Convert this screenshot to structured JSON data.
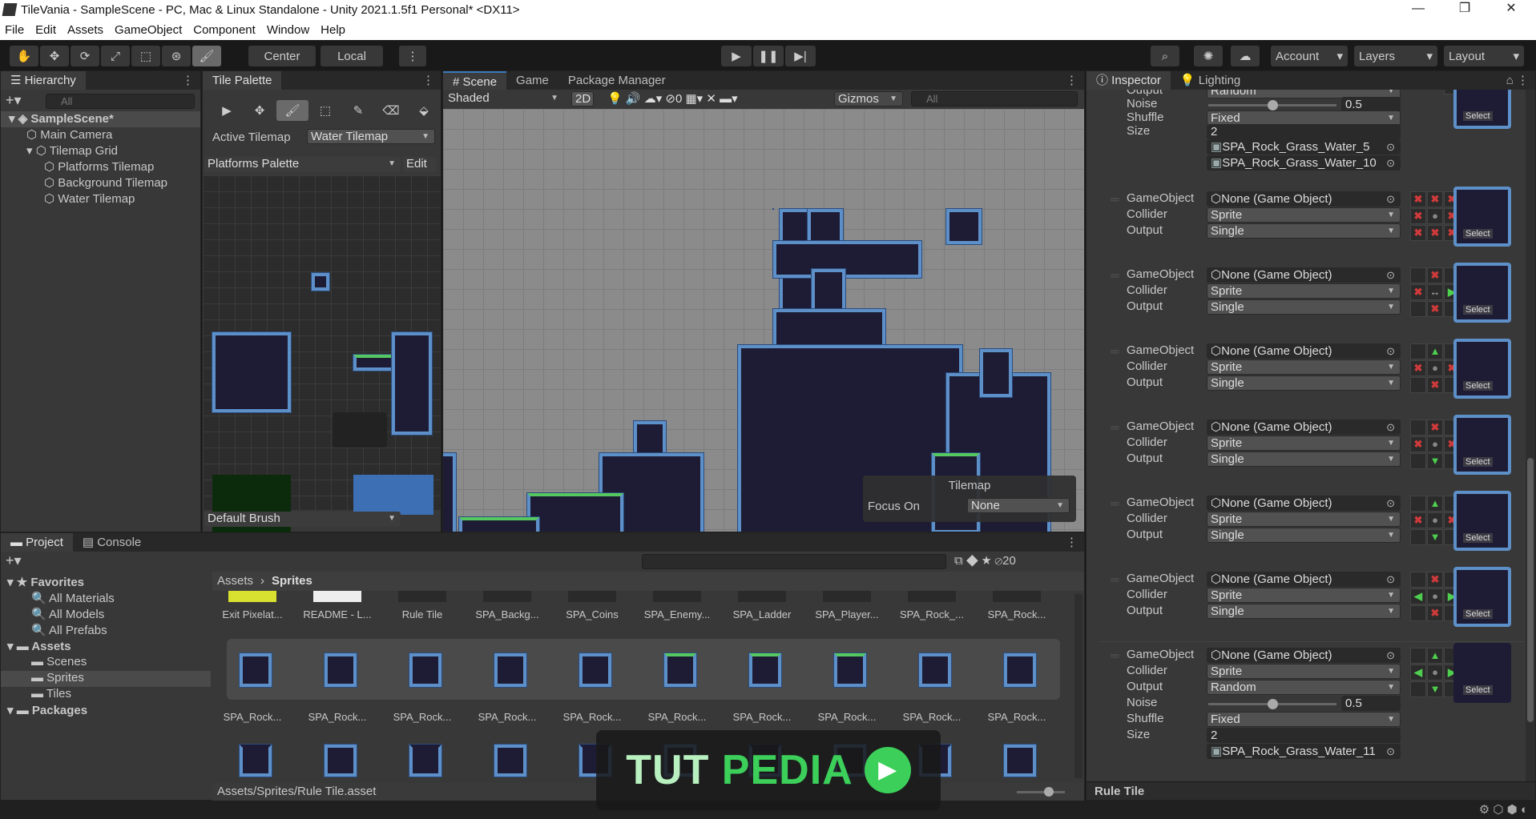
{
  "window": {
    "title": "TileVania - SampleScene - PC, Mac & Linux Standalone - Unity 2021.1.5f1 Personal* <DX11>",
    "minimize": "—",
    "restore": "❐",
    "close": "✕"
  },
  "menu": [
    "File",
    "Edit",
    "Assets",
    "GameObject",
    "Component",
    "Window",
    "Help"
  ],
  "toolbar": {
    "tools": [
      "✋",
      "✥",
      "⟳",
      "⤢",
      "⬚",
      "⊛",
      "🖌"
    ],
    "center": "Center",
    "local": "Local",
    "play": "▶",
    "pause": "❚❚",
    "step": "▶|",
    "account": "Account",
    "layers": "Layers",
    "layout": "Layout"
  },
  "hierarchy": {
    "tab": "Hierarchy",
    "search": "All",
    "items": [
      {
        "label": "SampleScene*",
        "depth": 0
      },
      {
        "label": "Main Camera",
        "depth": 1
      },
      {
        "label": "Tilemap Grid",
        "depth": 1
      },
      {
        "label": "Platforms Tilemap",
        "depth": 2
      },
      {
        "label": "Background Tilemap",
        "depth": 2
      },
      {
        "label": "Water Tilemap",
        "depth": 2
      }
    ]
  },
  "tile_palette": {
    "tab": "Tile Palette",
    "active_tilemap_label": "Active Tilemap",
    "active_tilemap": "Water Tilemap",
    "palette": "Platforms Palette",
    "edit": "Edit",
    "brush": "Default Brush",
    "tools": [
      "▶",
      "✥",
      "🖌",
      "⬚",
      "✎",
      "⌫",
      "⬙"
    ]
  },
  "scene": {
    "tabs": [
      "# Scene",
      "Game",
      "Package Manager"
    ],
    "shading": "Shaded",
    "mode_2d": "2D",
    "hidden_count": "0",
    "gizmos": "Gizmos",
    "search": "All",
    "overlay": {
      "title": "Tilemap",
      "focus_label": "Focus On",
      "focus_value": "None"
    }
  },
  "project": {
    "tabs": [
      "Project",
      "Console"
    ],
    "hidden_count": "20",
    "tree": [
      {
        "label": "Favorites",
        "depth": 0,
        "bold": true
      },
      {
        "label": "All Materials",
        "depth": 1
      },
      {
        "label": "All Models",
        "depth": 1
      },
      {
        "label": "All Prefabs",
        "depth": 1
      },
      {
        "label": "Assets",
        "depth": 0,
        "bold": true
      },
      {
        "label": "Scenes",
        "depth": 1
      },
      {
        "label": "Sprites",
        "depth": 1
      },
      {
        "label": "Tiles",
        "depth": 1
      },
      {
        "label": "Packages",
        "depth": 0,
        "bold": true
      }
    ],
    "breadcrumb": [
      "Assets",
      "Sprites"
    ],
    "assets_row1": [
      "Exit Pixelat...",
      "README - L...",
      "Rule Tile",
      "SPA_Backg...",
      "SPA_Coins",
      "SPA_Enemy...",
      "SPA_Ladder",
      "SPA_Player...",
      "SPA_Rock_...",
      "SPA_Rock..."
    ],
    "assets_row2": [
      "SPA_Rock...",
      "SPA_Rock...",
      "SPA_Rock...",
      "SPA_Rock...",
      "SPA_Rock...",
      "SPA_Rock...",
      "SPA_Rock...",
      "SPA_Rock...",
      "SPA_Rock...",
      "SPA_Rock..."
    ],
    "status_path": "Assets/Sprites/Rule Tile.asset"
  },
  "inspector": {
    "tabs": [
      "Inspector",
      "Lighting"
    ],
    "labels": {
      "gameobject": "GameObject",
      "collider": "Collider",
      "output": "Output",
      "noise": "Noise",
      "shuffle": "Shuffle",
      "size": "Size"
    },
    "none_go": "None (Game Object)",
    "select": "Select",
    "footer": "Rule Tile",
    "top_rule": {
      "output": "Random",
      "noise": "0.5",
      "noise_level": 0.5,
      "shuffle": "Fixed",
      "size": "2",
      "sprites": [
        "SPA_Rock_Grass_Water_5",
        "SPA_Rock_Grass_Water_10"
      ]
    },
    "rules": [
      {
        "collider": "Sprite",
        "output": "Single",
        "grid": "xxx x.x xxx"
      },
      {
        "collider": "Sprite",
        "output": "Single",
        "grid": "-x- x<R -x-"
      },
      {
        "collider": "Sprite",
        "output": "Single",
        "grid": "-U- x.x -x-"
      },
      {
        "collider": "Sprite",
        "output": "Single",
        "grid": "-x- x.x -D-"
      },
      {
        "collider": "Sprite",
        "output": "Single",
        "grid": "-U- x.x -D-"
      },
      {
        "collider": "Sprite",
        "output": "Single",
        "grid": "-x- L.R -x-"
      },
      {
        "collider": "Sprite",
        "output": "Random",
        "grid": "-U- L.R -D-",
        "noise": "0.5",
        "shuffle": "Fixed",
        "size": "2",
        "sprites": [
          "SPA_Rock_Grass_Water_11"
        ]
      }
    ]
  },
  "watermark": {
    "text": "TUTPEDIA"
  },
  "colors": {
    "accent": "#3a79bb",
    "tile_edge": "#5d8fc8",
    "grass": "#55c860",
    "red_x": "#d03a3a",
    "green_arrow": "#4fcf4f"
  }
}
